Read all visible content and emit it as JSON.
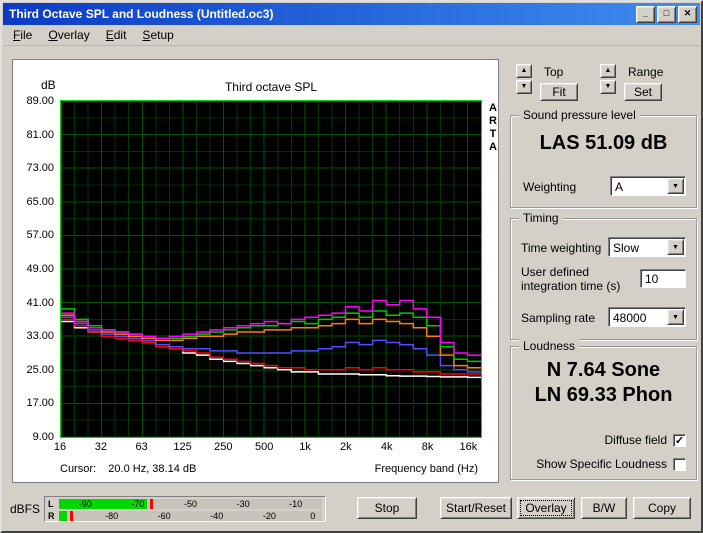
{
  "window": {
    "title": "Third Octave SPL and Loudness (Untitled.oc3)"
  },
  "icons": {
    "minimize": "_",
    "maximize": "□",
    "close": "✕",
    "up": "▲",
    "down": "▼",
    "dropdown": "▼",
    "check": "✓"
  },
  "menu": {
    "items": [
      {
        "label": "File"
      },
      {
        "label": "Overlay"
      },
      {
        "label": "Edit"
      },
      {
        "label": "Setup"
      }
    ]
  },
  "view_controls": {
    "top_label": "Top",
    "fit_button": "Fit",
    "range_label": "Range",
    "set_button": "Set"
  },
  "plot": {
    "db_label": "dB",
    "title": "Third octave SPL",
    "watermark": "ARTA",
    "y_ticks": [
      "89.00",
      "81.00",
      "73.00",
      "65.00",
      "57.00",
      "49.00",
      "41.00",
      "33.00",
      "25.00",
      "17.00",
      "9.00"
    ],
    "x_ticks": [
      "16",
      "32",
      "63",
      "125",
      "250",
      "500",
      "1k",
      "2k",
      "4k",
      "8k",
      "16k"
    ],
    "cursor_text": "Cursor:    20.0 Hz, 38.14 dB",
    "x_axis_label": "Frequency band (Hz)"
  },
  "chart_data": {
    "type": "step-line",
    "title": "Third octave SPL",
    "xlabel": "Frequency band (Hz)",
    "ylabel": "dB",
    "ylim": [
      9,
      89
    ],
    "y_major_step": 8,
    "grid": true,
    "x_bands": [
      16,
      20,
      25,
      31.5,
      40,
      50,
      63,
      80,
      100,
      125,
      160,
      200,
      250,
      315,
      400,
      500,
      630,
      800,
      1000,
      1250,
      1600,
      2000,
      2500,
      3150,
      4000,
      5000,
      6300,
      8000,
      10000,
      12500,
      16000
    ],
    "x_tick_indices": [
      0,
      3,
      6,
      9,
      12,
      15,
      18,
      21,
      24,
      27,
      30
    ],
    "series": [
      {
        "name": "white",
        "color": "#ffffff",
        "values": [
          36.5,
          35,
          34,
          33,
          32.5,
          32,
          31.5,
          30.5,
          30,
          29,
          28.5,
          27.5,
          27,
          26.5,
          26,
          25.5,
          25,
          24.5,
          24.5,
          24,
          24,
          24,
          23.8,
          23.8,
          23.6,
          23.5,
          23.5,
          23.4,
          23.3,
          23.3,
          23.2
        ]
      },
      {
        "name": "red",
        "color": "#ff0000",
        "values": [
          37,
          35.5,
          34,
          33,
          32.5,
          32,
          31.5,
          30.5,
          30,
          29.5,
          29,
          28,
          27.5,
          27,
          26.5,
          26,
          25.5,
          25.5,
          25,
          25,
          25,
          25.5,
          25,
          25.5,
          25,
          25,
          24.5,
          24.5,
          24,
          24,
          24
        ]
      },
      {
        "name": "blue",
        "color": "#5050ff",
        "values": [
          37.5,
          36,
          34.5,
          33.5,
          33,
          32.5,
          32,
          31,
          30.5,
          30,
          30,
          29.5,
          29.5,
          29,
          29,
          29,
          29,
          29.5,
          29.5,
          30,
          30.5,
          31.5,
          31,
          32,
          31.5,
          31,
          30,
          28.5,
          26,
          25,
          24.5
        ]
      },
      {
        "name": "orange",
        "color": "#ff8000",
        "values": [
          38,
          36.5,
          35,
          34,
          33.5,
          33,
          32.5,
          32,
          32,
          32.5,
          33,
          33,
          33.5,
          34,
          34,
          34.5,
          34.5,
          35,
          35,
          35.5,
          36,
          37,
          36,
          37,
          36.5,
          36,
          35,
          33,
          28.5,
          26,
          25.5
        ]
      },
      {
        "name": "green",
        "color": "#00c800",
        "values": [
          39.5,
          37,
          35.5,
          34.5,
          34,
          33.5,
          33,
          32.5,
          32.5,
          33,
          33.5,
          34,
          34.5,
          35,
          35.5,
          35.5,
          36,
          36.5,
          36,
          37,
          37.5,
          38.5,
          37.5,
          39,
          38,
          38.5,
          37.5,
          35.5,
          30.5,
          27.5,
          27
        ]
      },
      {
        "name": "magenta",
        "color": "#ff00ff",
        "values": [
          38.5,
          36.5,
          35,
          34.5,
          34,
          33.5,
          33,
          32.5,
          33,
          33.5,
          34,
          34.5,
          35,
          35.5,
          36,
          36.5,
          36,
          37,
          37.5,
          38,
          38.5,
          40,
          39,
          41.5,
          40.5,
          41.5,
          39.5,
          37.5,
          31.5,
          29,
          28.5
        ]
      }
    ]
  },
  "spl_group": {
    "legend": "Sound pressure level",
    "reading": "LAS 51.09 dB",
    "weighting_label": "Weighting",
    "weighting_value": "A"
  },
  "timing_group": {
    "legend": "Timing",
    "time_weighting_label": "Time weighting",
    "time_weighting_value": "Slow",
    "integration_label_line1": "User defined",
    "integration_label_line2": "integration time (s)",
    "integration_value": "10",
    "sampling_rate_label": "Sampling rate",
    "sampling_rate_value": "48000"
  },
  "loudness_group": {
    "legend": "Loudness",
    "n_reading": "N 7.64 Sone",
    "ln_reading": "LN 69.33 Phon",
    "checkboxes": [
      {
        "label": "Diffuse field",
        "checked": true
      },
      {
        "label": "Show Specific Loudness",
        "checked": false
      }
    ]
  },
  "meter": {
    "unit_label": "dBFS",
    "scale_range": [
      -100,
      0
    ],
    "channels": [
      {
        "label": "L",
        "level_pct": 33.5,
        "peak_pct": 34.5,
        "ticks": [
          -90,
          -70,
          -50,
          -30,
          -10
        ]
      },
      {
        "label": "R",
        "level_pct": 3.0,
        "peak_pct": 4.0,
        "ticks": [
          -80,
          -60,
          -40,
          -20,
          0
        ]
      }
    ]
  },
  "bottom": {
    "buttons": [
      {
        "label": "Stop",
        "focused": false
      },
      {
        "label": "Start/Reset",
        "focused": false
      },
      {
        "label": "Overlay",
        "focused": true
      },
      {
        "label": "B/W",
        "focused": false
      },
      {
        "label": "Copy",
        "focused": false
      }
    ]
  }
}
